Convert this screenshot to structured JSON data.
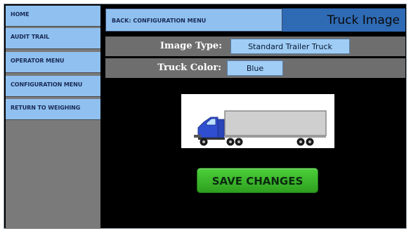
{
  "sidebar": {
    "items": [
      {
        "label": "HOME"
      },
      {
        "label": "AUDIT TRAIL"
      },
      {
        "label": "OPERATOR MENU"
      },
      {
        "label": "CONFIGURATION MENU"
      },
      {
        "label": "RETURN TO WEIGHING"
      }
    ]
  },
  "header": {
    "back_label": "BACK: CONFIGURATION MENU",
    "title": "Truck Image"
  },
  "fields": {
    "image_type": {
      "label": "Image Type:",
      "value": "Standard Trailer Truck"
    },
    "truck_color": {
      "label": "Truck Color:",
      "value": "Blue"
    }
  },
  "preview": {
    "icon": "truck-icon",
    "cab_color": "#2f4fd0"
  },
  "actions": {
    "save_label": "SAVE CHANGES"
  },
  "colors": {
    "nav_button": "#8fc0f0",
    "title_bar": "#2f6ab4",
    "save_button": "#3fbf2c",
    "background": "#000000"
  }
}
